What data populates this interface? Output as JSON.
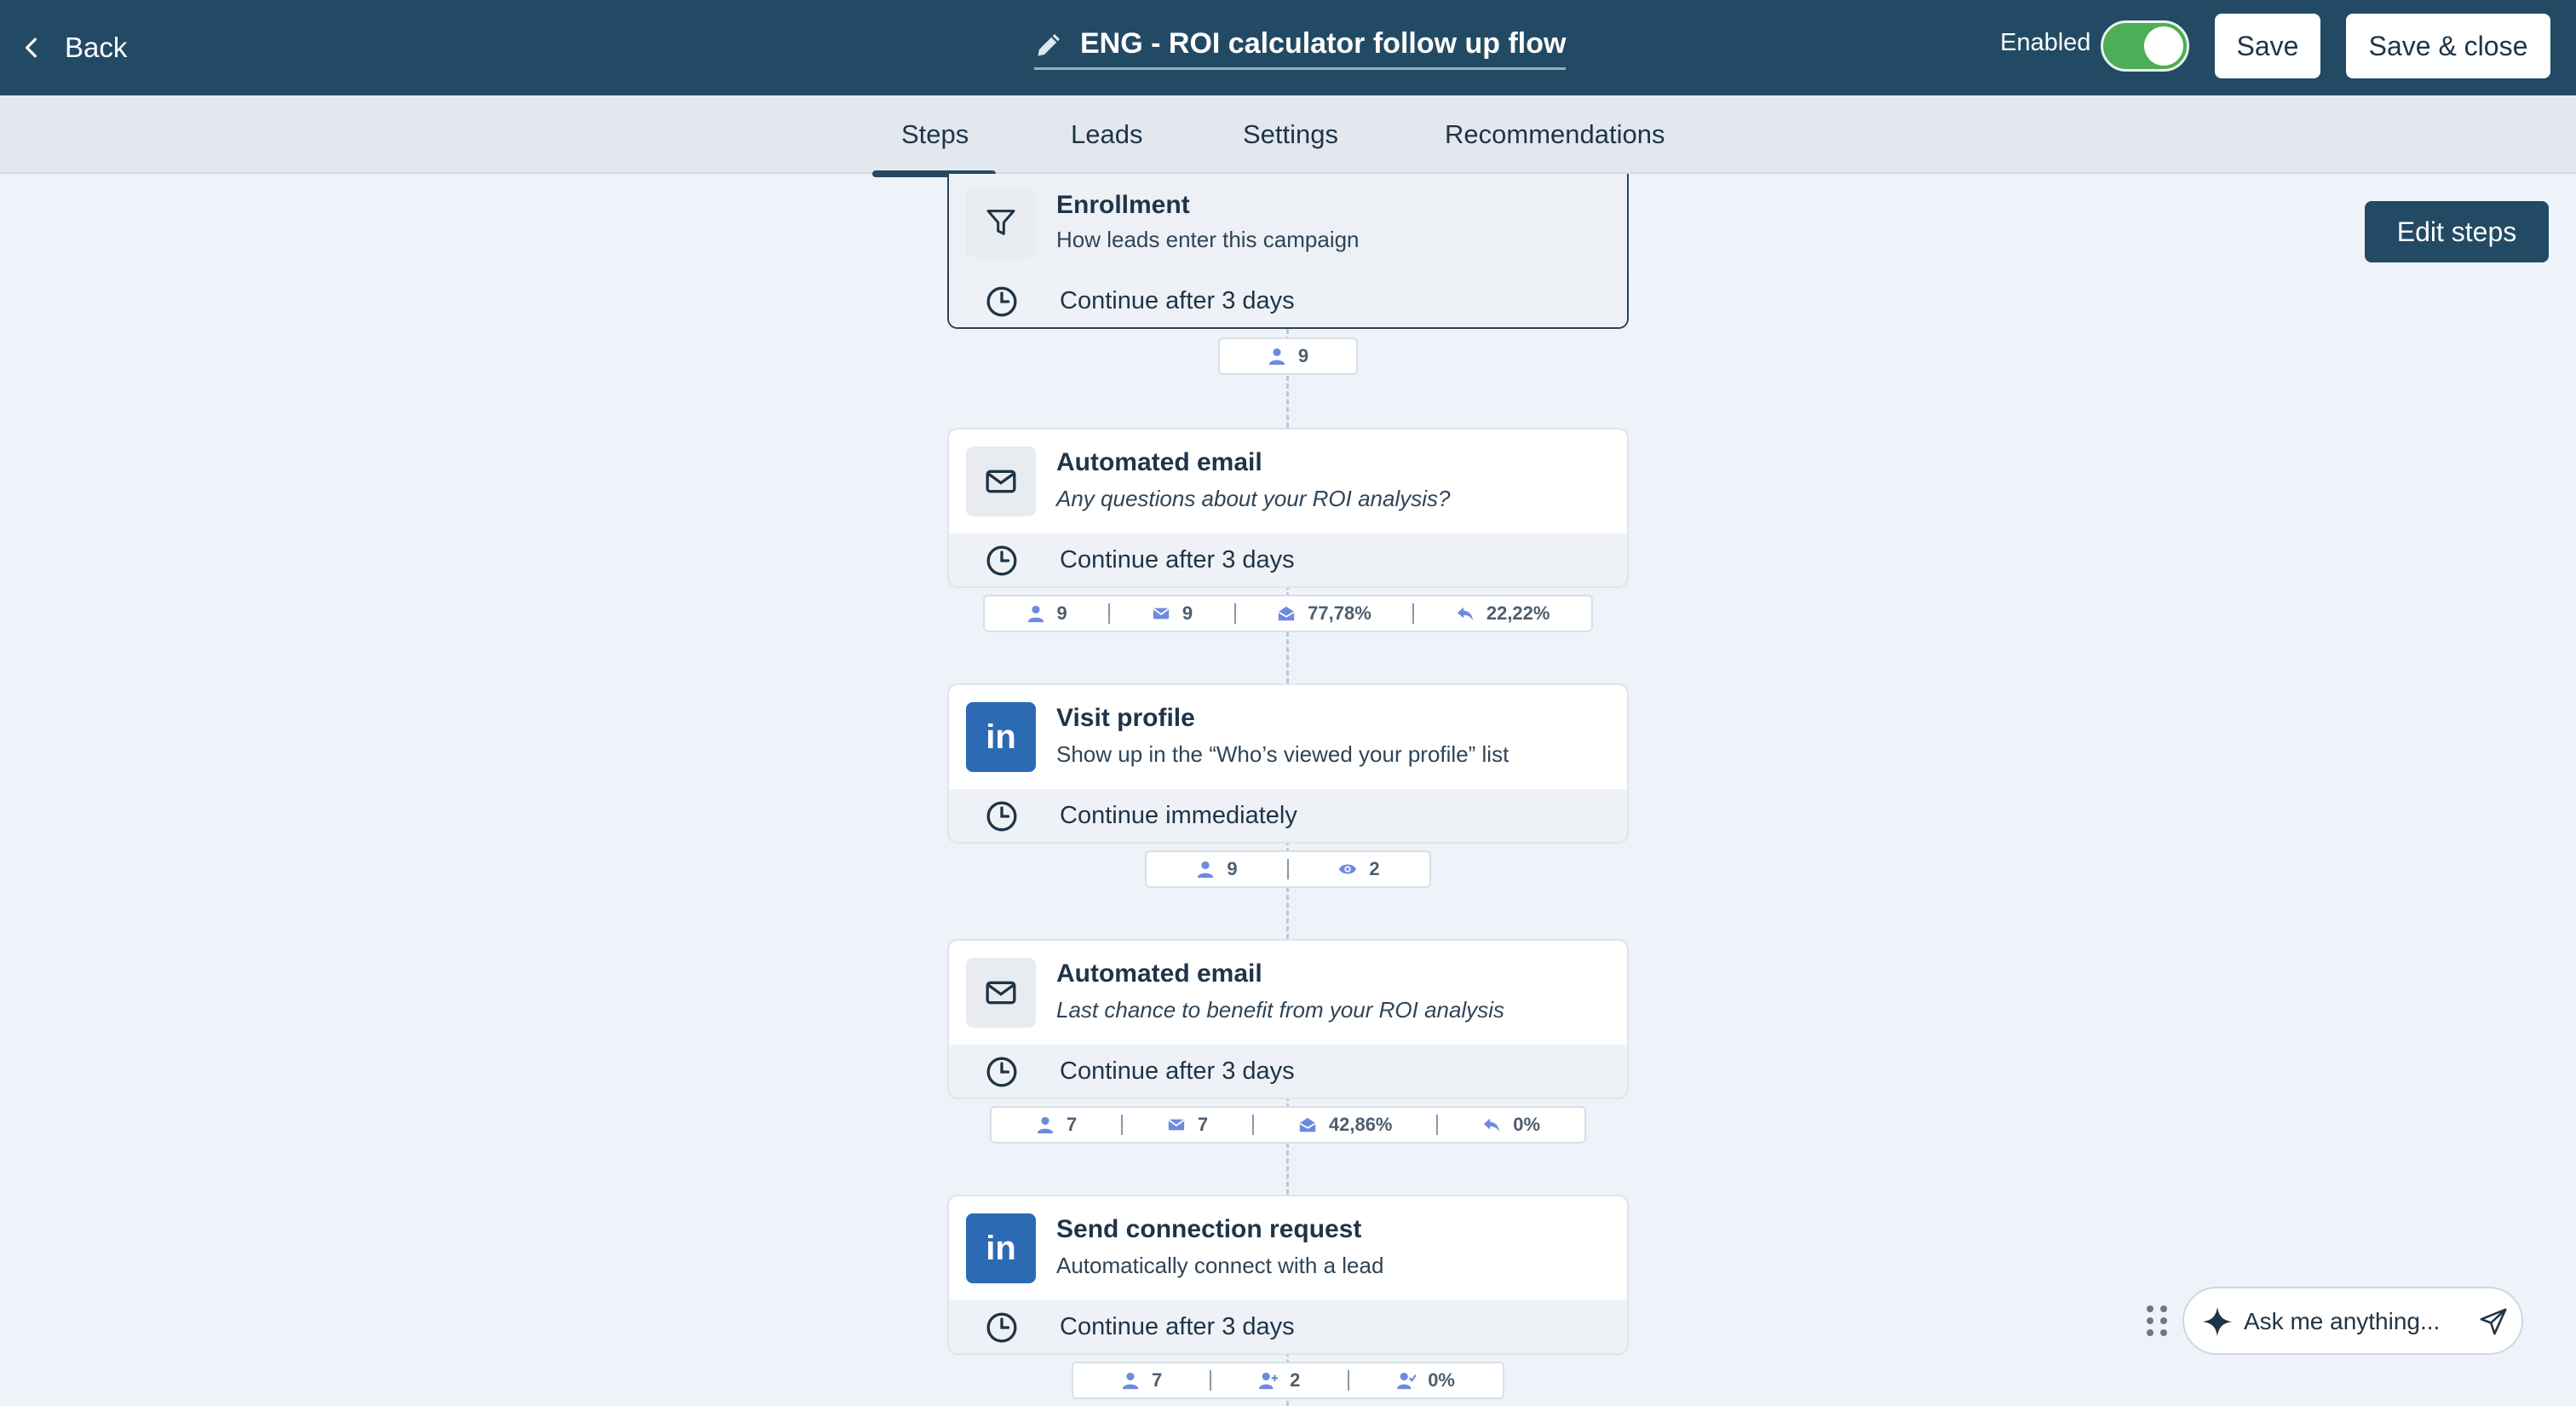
{
  "header": {
    "back_label": "Back",
    "title": "ENG - ROI calculator follow up flow",
    "enabled_label": "Enabled",
    "enabled": true,
    "save_label": "Save",
    "save_close_label": "Save & close"
  },
  "tabs": [
    {
      "label": "Steps",
      "active": true
    },
    {
      "label": "Leads",
      "active": false
    },
    {
      "label": "Settings",
      "active": false
    },
    {
      "label": "Recommendations",
      "active": false
    }
  ],
  "edit_steps_label": "Edit steps",
  "steps": [
    {
      "type": "enrollment",
      "icon": "filter-icon",
      "title": "Enrollment",
      "subtitle": "How leads enter this campaign",
      "delay": "Continue after 3 days",
      "stats": [
        {
          "icon": "person-icon",
          "value": "9"
        }
      ]
    },
    {
      "type": "email",
      "icon": "mail-icon",
      "title": "Automated email",
      "subtitle": "Any questions about your ROI analysis?",
      "delay": "Continue after 3 days",
      "stats": [
        {
          "icon": "person-icon",
          "value": "9"
        },
        {
          "icon": "sent-mail-icon",
          "value": "9"
        },
        {
          "icon": "opened-mail-icon",
          "value": "77,78%"
        },
        {
          "icon": "reply-icon",
          "value": "22,22%"
        }
      ]
    },
    {
      "type": "linkedin",
      "icon": "linkedin-icon",
      "title": "Visit profile",
      "subtitle": "Show up in the “Who’s viewed your profile” list",
      "delay": "Continue immediately",
      "stats": [
        {
          "icon": "person-icon",
          "value": "9"
        },
        {
          "icon": "eye-icon",
          "value": "2"
        }
      ]
    },
    {
      "type": "email",
      "icon": "mail-icon",
      "title": "Automated email",
      "subtitle": "Last chance to benefit from your ROI analysis",
      "delay": "Continue after 3 days",
      "stats": [
        {
          "icon": "person-icon",
          "value": "7"
        },
        {
          "icon": "sent-mail-icon",
          "value": "7"
        },
        {
          "icon": "opened-mail-icon",
          "value": "42,86%"
        },
        {
          "icon": "reply-icon",
          "value": "0%"
        }
      ]
    },
    {
      "type": "linkedin",
      "icon": "linkedin-icon",
      "title": "Send connection request",
      "subtitle": "Automatically connect with a lead",
      "delay": "Continue after 3 days",
      "stats": [
        {
          "icon": "person-icon",
          "value": "7"
        },
        {
          "icon": "person-plus-icon",
          "value": "2"
        },
        {
          "icon": "person-check-icon",
          "value": "0%"
        }
      ]
    }
  ],
  "linkedin_glyph": "in",
  "assistant": {
    "placeholder": "Ask me anything..."
  },
  "colors": {
    "header": "#234a64",
    "toggle_on": "#4cae56",
    "linkedin": "#2c6bb3",
    "stat_icon": "#6d8ae0"
  }
}
